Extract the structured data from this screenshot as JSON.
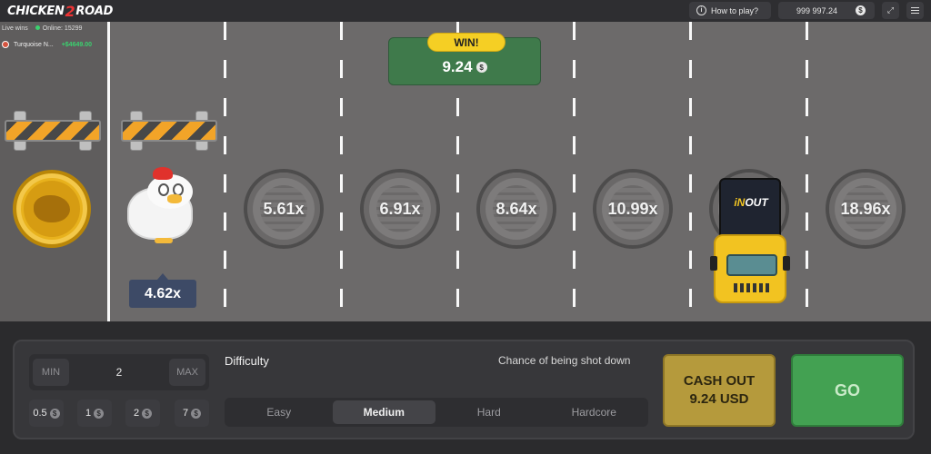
{
  "header": {
    "logo_left": "CHICKEN",
    "logo_num": "2",
    "logo_right": "ROAD",
    "how_to_play": "How to play?",
    "balance": "999 997.24",
    "currency_icon": "$",
    "fullscreen_icon": "fullscreen-icon",
    "menu_icon": "menu-icon"
  },
  "live": {
    "label": "Live wins",
    "online": "Online: 15299",
    "winner_name": "Turquoise N...",
    "winner_amount": "+$4649.00"
  },
  "win": {
    "label": "WIN!",
    "value": "9.24",
    "currency_icon": "$"
  },
  "road": {
    "current_multiplier": "4.62x",
    "multipliers": [
      "5.61x",
      "6.91x",
      "8.64x",
      "10.99x",
      "",
      "18.96x"
    ],
    "truck_logo_in": "iN",
    "truck_logo_out": "OUT"
  },
  "controls": {
    "min_label": "MIN",
    "max_label": "MAX",
    "stake_value": "2",
    "quick_bets": [
      "0.5",
      "1",
      "2",
      "7"
    ],
    "currency_icon": "$",
    "difficulty_label": "Difficulty",
    "chance_label": "Chance of being shot down",
    "difficulties": [
      "Easy",
      "Medium",
      "Hard",
      "Hardcore"
    ],
    "active_difficulty": "Medium",
    "cashout_line1": "CASH OUT",
    "cashout_line2": "9.24 USD",
    "go_label": "GO"
  },
  "colors": {
    "road": "#6c6a6a",
    "win_green": "#3f7a4b",
    "win_tag": "#f5cf24",
    "cashout": "#b59a3c",
    "go": "#43a152"
  }
}
